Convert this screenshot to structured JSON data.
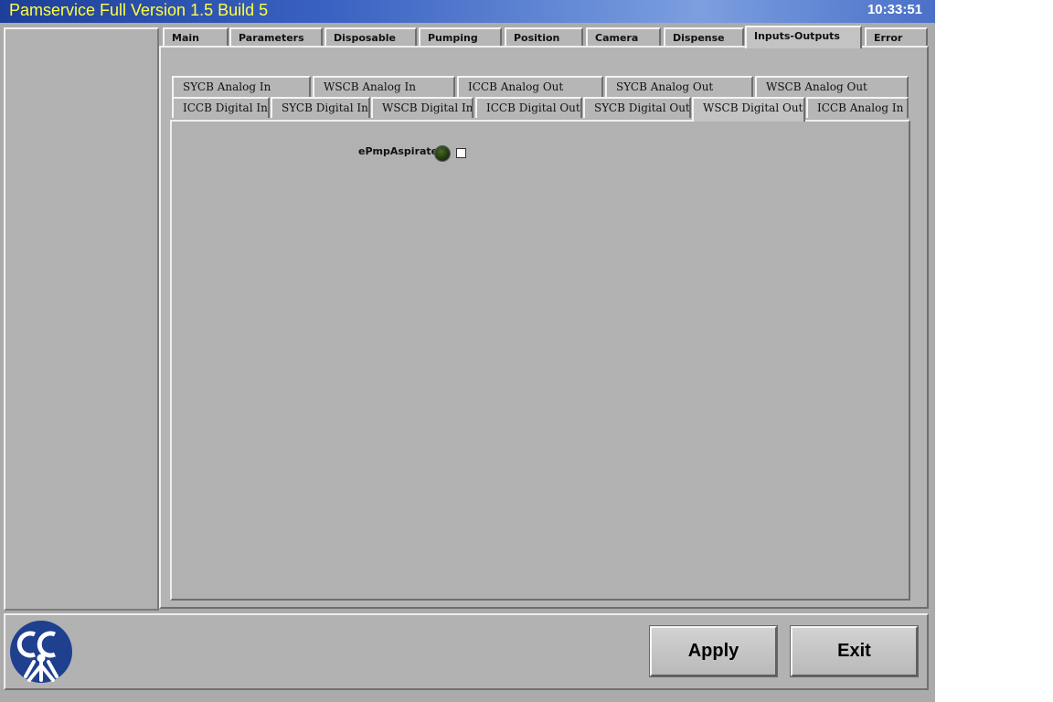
{
  "window": {
    "title": "Pamservice Full Version 1.5 Build 5",
    "clock": "10:33:51"
  },
  "main_tabs": [
    {
      "label": "Main"
    },
    {
      "label": "Parameters"
    },
    {
      "label": "Disposable"
    },
    {
      "label": "Pumping"
    },
    {
      "label": "Position"
    },
    {
      "label": "Camera"
    },
    {
      "label": "Dispense"
    },
    {
      "label": "Inputs-Outputs",
      "active": true
    },
    {
      "label": "Error"
    }
  ],
  "sub_tabs_row1": [
    {
      "label": "SYCB Analog In"
    },
    {
      "label": "WSCB Analog In"
    },
    {
      "label": "ICCB Analog Out"
    },
    {
      "label": "SYCB Analog Out"
    },
    {
      "label": "WSCB Analog Out"
    }
  ],
  "sub_tabs_row2": [
    {
      "label": "ICCB Digital In"
    },
    {
      "label": "SYCB Digital In"
    },
    {
      "label": "WSCB Digital In"
    },
    {
      "label": "ICCB Digital Out"
    },
    {
      "label": "SYCB Digital Out"
    },
    {
      "label": "WSCB Digital Out",
      "active": true
    },
    {
      "label": "ICCB Analog In"
    }
  ],
  "io_items": [
    {
      "label": "ePmpAspirate",
      "led_state": "off",
      "checked": false
    }
  ],
  "buttons": {
    "apply": "Apply",
    "exit": "Exit"
  },
  "colors": {
    "title_text": "#ffff40",
    "led_off": "#223a12",
    "logo_blue": "#1f3f8f"
  },
  "icons": {
    "led": "led-indicator-icon",
    "logo": "company-logo-icon"
  }
}
